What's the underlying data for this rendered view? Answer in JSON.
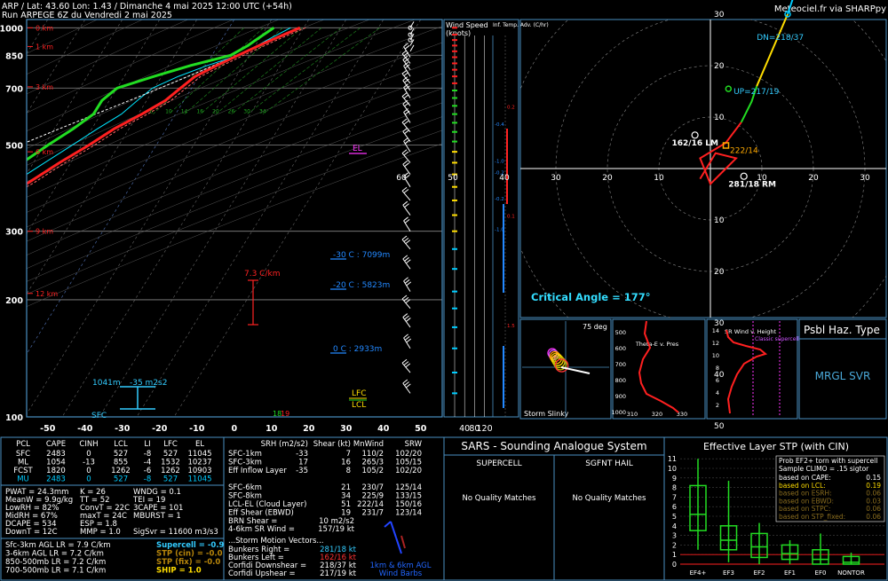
{
  "header": {
    "line1": "ARP / Lat: 43.60 Lon: 1.43 / Dimanche 4 mai 2025 12:00 UTC (+54h)",
    "line2": "Run ARPEGE 6Z du Vendredi 2 mai 2025",
    "brand": "Meteociel.fr via SHARPpy"
  },
  "colors": {
    "temperature": "#ff2020",
    "dewpoint": "#22dd22",
    "virtual_temp": "#ff6666",
    "parcel": "#ffffff",
    "wetbulb": "#00e5ff",
    "frame": "#4a90c2",
    "hodo_0_3": "#ff2020",
    "hodo_3_6": "#22dd22",
    "hodo_6_9": "#ffdd00",
    "hodo_9_12": "#00ccff",
    "storm_motion": "#ffaa00"
  },
  "chart_data": [
    {
      "type": "line",
      "title": "Skew-T log-P",
      "p_ticks": [
        "100",
        "200",
        "300",
        "500",
        "700",
        "850",
        "1000"
      ],
      "t_ticks": [
        "-50",
        "-40",
        "-30",
        "-20",
        "-10",
        "0",
        "10",
        "20",
        "30",
        "40",
        "50"
      ],
      "height_labels": [
        "12 km",
        "9 km",
        "6 km",
        "3 km",
        "1 km",
        "0 km"
      ],
      "height_values_km": [
        12,
        9,
        6,
        3,
        1,
        0
      ],
      "pressure_levels_hpa": [
        1000,
        950,
        925,
        900,
        850,
        800,
        750,
        700,
        650,
        600,
        550,
        500,
        450,
        400,
        350,
        300,
        250,
        220,
        200,
        180,
        150,
        120,
        100
      ],
      "series": [
        {
          "name": "T",
          "values": [
            19,
            15,
            13,
            11,
            7,
            3,
            -1,
            -3,
            -5,
            -9,
            -14,
            -18,
            -23,
            -28,
            -35,
            -42,
            -50,
            -55,
            -52,
            -49,
            -46,
            -44,
            -43
          ]
        },
        {
          "name": "Td",
          "values": [
            12,
            10,
            9,
            8,
            5,
            -4,
            -12,
            -20,
            -22,
            -22,
            -25,
            -29,
            -33,
            -38,
            -45,
            -52,
            -60,
            -63,
            -66,
            -61,
            -58,
            -57,
            -57
          ]
        }
      ],
      "annotations": {
        "lr_box": "7.3 C/km",
        "el": "EL",
        "lfc": "LFC",
        "lcl": "LCL",
        "lvl_m30": "-30 C : 7099m",
        "lvl_m20": "-20 C : 5823m",
        "lvl_0": "0 C : 2933m",
        "eff_inflow_top": "1041m",
        "eff_inflow_srh": "-35 m2s2",
        "sfc": "SFC",
        "mix_ticks": [
          "6",
          "10",
          "14",
          "16",
          "20",
          "26",
          "30",
          "34"
        ],
        "sfc_values": [
          "18",
          "19"
        ]
      }
    },
    {
      "type": "line",
      "title": "Wind Speed (knots)",
      "header": "Wind Speed",
      "header2": "(knots)",
      "x_ticks": [
        "40",
        "80",
        "120"
      ],
      "adv_header": "Inf. Temp. Adv. (C/hr)",
      "adv_values": [
        "1.5",
        "-1.0",
        "0.1",
        "-0.2",
        "-0.2",
        "-1.0",
        "-0.4",
        "0.2"
      ]
    },
    {
      "type": "scatter",
      "title": "Hodograph",
      "ticks": [
        "60",
        "50",
        "40",
        "30",
        "20",
        "10"
      ],
      "critical_angle": "Critical Angle = 177°",
      "dn_label": "DN=218/37",
      "up_label": "UP=217/19",
      "lm_label": "162/16 LM",
      "rm_label": "281/18 RM",
      "mean_label": "222/14",
      "series": [
        {
          "name": "0-3 km",
          "x": [
            -2,
            1,
            5,
            3,
            0,
            -2,
            3,
            6
          ],
          "y": [
            -2,
            3,
            2,
            0,
            -3,
            2,
            5,
            9
          ]
        },
        {
          "name": "3-6 km",
          "x": [
            6,
            8,
            9
          ],
          "y": [
            9,
            13,
            16
          ]
        },
        {
          "name": "6-9 km",
          "x": [
            9,
            12,
            15
          ],
          "y": [
            16,
            23,
            30
          ]
        },
        {
          "name": "9-12 km",
          "x": [
            15,
            17,
            19,
            16,
            23
          ],
          "y": [
            30,
            36,
            46,
            48,
            47
          ]
        }
      ]
    }
  ],
  "inset": {
    "slinky_angle": "75 deg",
    "slinky_title": "Storm Slinky",
    "thetae_title": "Theta-E v. Pres",
    "thetae_p": [
      "500",
      "600",
      "700",
      "800",
      "900",
      "1000"
    ],
    "thetae_t": [
      "310",
      "320",
      "330"
    ],
    "srwind_title": "SR Wind v. Height",
    "srwind_h": [
      "14",
      "12",
      "10",
      "8",
      "6",
      "4",
      "2"
    ],
    "srwind_label": "Classic supercell",
    "haz_title": "Psbl Haz. Type",
    "haz_value": "MRGL SVR"
  },
  "parcel_table": {
    "headers": [
      "PCL",
      "CAPE",
      "CINH",
      "LCL",
      "LI",
      "LFC",
      "EL"
    ],
    "rows": [
      [
        "SFC",
        "2483",
        "0",
        "527",
        "-8",
        "527",
        "11045"
      ],
      [
        "ML",
        "1054",
        "-13",
        "855",
        "-4",
        "1532",
        "10237"
      ],
      [
        "FCST",
        "1820",
        "0",
        "1262",
        "-6",
        "1262",
        "10903"
      ],
      [
        "MU",
        "2483",
        "0",
        "527",
        "-8",
        "527",
        "11045"
      ]
    ]
  },
  "indices": {
    "c1": [
      "PWAT = 24.3mm",
      "MeanW = 9.9g/kg",
      "LowRH = 82%",
      "MidRH = 67%",
      "DCAPE = 534",
      "DownT = 12C"
    ],
    "c2": [
      "K = 26",
      "TT = 52",
      "ConvT = 22C",
      "maxT = 24C",
      "ESP = 1.8",
      "MMP = 1.0"
    ],
    "c3": [
      "WNDG = 0.1",
      "TEI = 19",
      "3CAPE = 101",
      "MBURST = 1",
      "",
      "SigSvr = 11600 m3/s3"
    ]
  },
  "lapse": [
    "Sfc-3km AGL LR = 7.9 C/km",
    "3-6km AGL LR = 7.2 C/km",
    "850-500mb LR = 7.2 C/km",
    "700-500mb LR = 7.1 C/km"
  ],
  "composite": [
    "Supercell = -0.9",
    "STP (cin) = -0.0",
    "STP (fix) = -0.0",
    "SHIP = 1.0"
  ],
  "kinematics": {
    "headers": [
      "SRH (m2/s2)",
      "Shear (kt)",
      "MnWind",
      "SRW"
    ],
    "rows": [
      [
        "SFC-1km",
        "-33",
        "7",
        "110/2",
        "102/20"
      ],
      [
        "SFC-3km",
        "17",
        "16",
        "265/3",
        "105/15"
      ],
      [
        "Eff Inflow Layer",
        "-35",
        "8",
        "105/2",
        "102/20"
      ],
      [
        "",
        "",
        "",
        "",
        ""
      ],
      [
        "SFC-6km",
        "",
        "21",
        "230/7",
        "125/14"
      ],
      [
        "SFC-8km",
        "",
        "34",
        "225/9",
        "133/15"
      ],
      [
        "LCL-EL (Cloud Layer)",
        "",
        "51",
        "222/14",
        "150/16"
      ],
      [
        "Eff Shear (EBWD)",
        "",
        "19",
        "231/7",
        "123/14"
      ]
    ],
    "brn": "BRN Shear =",
    "brn_val": "10 m2/s2",
    "srw46": "4-6km SR Wind =",
    "srw46_val": "157/19 kt",
    "motion_title": "...Storm Motion Vectors...",
    "motion": [
      [
        "Bunkers Right =",
        "281/18 kt"
      ],
      [
        "Bunkers Left =",
        "162/16 kt"
      ],
      [
        "Corfidi Downshear =",
        "218/37 kt"
      ],
      [
        "Corfidi Upshear =",
        "217/19 kt"
      ]
    ],
    "barbs_label1": "1km & 6km AGL",
    "barbs_label2": "Wind Barbs"
  },
  "sars": {
    "title": "SARS - Sounding Analogue System",
    "h1": "SUPERCELL",
    "h2": "SGFNT HAIL",
    "m1": "No Quality Matches",
    "m2": "No Quality Matches"
  },
  "stp": {
    "title": "Effective Layer STP (with CIN)",
    "yticks": [
      "11",
      "10",
      "9",
      "8",
      "7",
      "6",
      "5",
      "4",
      "3",
      "2",
      "1",
      "0"
    ],
    "categories": [
      "EF4+",
      "EF3",
      "EF2",
      "EF1",
      "EF0",
      "NONTOR"
    ],
    "legend_title1": "Prob EF2+ torn with supercell",
    "legend_title2": "Sample CLIMO = .15 sigtor",
    "legend": [
      [
        "based on CAPE:",
        "0.15"
      ],
      [
        "based on LCL:",
        "0.19"
      ],
      [
        "based on ESRH:",
        "0.06"
      ],
      [
        "based on EBWD:",
        "0.03"
      ],
      [
        "based on STPC:",
        "0.06"
      ],
      [
        "based on STP_fixed:",
        "0.06"
      ]
    ]
  }
}
